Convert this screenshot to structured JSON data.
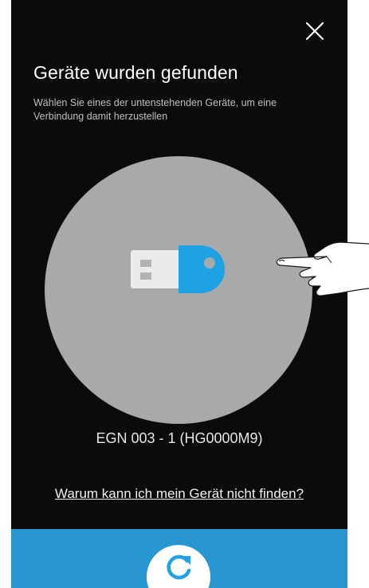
{
  "screen": {
    "title": "Geräte wurden gefunden",
    "subtitle": "Wählen Sie eines der untenstehenden Geräte, um eine Verbindung damit herzustellen"
  },
  "header": {
    "close_icon": "close-icon"
  },
  "devices": [
    {
      "name": "EGN 003 - 1 (HG0000M9)",
      "icon": "usb-key-icon",
      "icon_accent_color": "#1ea2e3"
    }
  ],
  "help": {
    "link_text": "Warum kann ich mein Gerät nicht finden?"
  },
  "footer": {
    "refresh_icon": "refresh-icon",
    "bar_color": "#2897cf"
  },
  "colors": {
    "background": "#0b0b0b",
    "device_circle": "#a7a9ab",
    "accent": "#1ea2e3"
  }
}
